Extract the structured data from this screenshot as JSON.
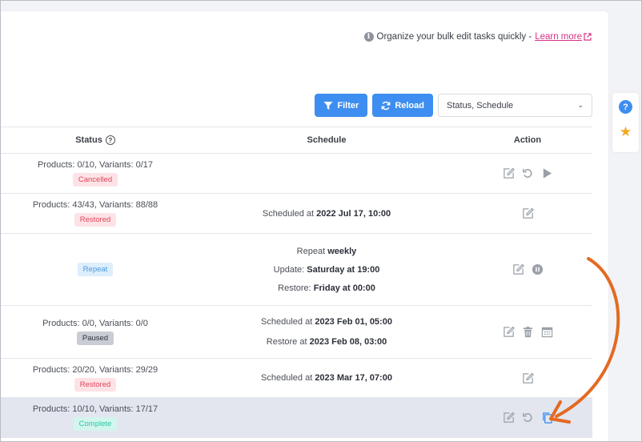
{
  "tip": {
    "text": "Organize your bulk edit tasks quickly -",
    "link": "Learn more"
  },
  "toolbar": {
    "filter_label": "Filter",
    "reload_label": "Reload",
    "select_value": "Status, Schedule"
  },
  "table": {
    "headers": {
      "status": "Status",
      "schedule": "Schedule",
      "action": "Action"
    },
    "rows": [
      {
        "summary": "Products: 0/10, Variants: 0/17",
        "badge": "Cancelled",
        "schedule_lines": [],
        "actions": [
          "edit-icon",
          "undo-icon",
          "play-icon"
        ]
      },
      {
        "summary": "Products: 43/43, Variants: 88/88",
        "badge": "Restored",
        "schedule_lines": [
          {
            "prefix": "Scheduled at",
            "value": "2022 Jul 17, 10:00"
          }
        ],
        "actions": [
          "edit-icon"
        ]
      },
      {
        "summary": "",
        "badge": "Repeat",
        "schedule_lines": [
          {
            "prefix": "Repeat",
            "value": "weekly"
          },
          {
            "prefix": "Update:",
            "value": "Saturday at 19:00"
          },
          {
            "prefix": "Restore:",
            "value": "Friday at 00:00"
          }
        ],
        "actions": [
          "edit-icon",
          "pause-icon"
        ]
      },
      {
        "summary": "Products: 0/0, Variants: 0/0",
        "badge": "Paused",
        "schedule_lines": [
          {
            "prefix": "Scheduled at",
            "value": "2023 Feb 01, 05:00"
          },
          {
            "prefix": "Restore at",
            "value": "2023 Feb 08, 03:00"
          }
        ],
        "actions": [
          "edit-icon",
          "trash-icon",
          "calendar-icon"
        ]
      },
      {
        "summary": "Products: 20/20, Variants: 29/29",
        "badge": "Restored",
        "schedule_lines": [
          {
            "prefix": "Scheduled at",
            "value": "2023 Mar 17, 07:00"
          }
        ],
        "actions": [
          "edit-icon"
        ]
      },
      {
        "summary": "Products: 10/10, Variants: 17/17",
        "badge": "Complete",
        "schedule_lines": [],
        "actions": [
          "edit-icon",
          "undo-icon",
          "copy-icon"
        ]
      }
    ]
  },
  "colors": {
    "primary": "#3d8ef0",
    "link": "#d63384",
    "annotation_arrow": "#e36a22",
    "star": "#f4a71d"
  }
}
